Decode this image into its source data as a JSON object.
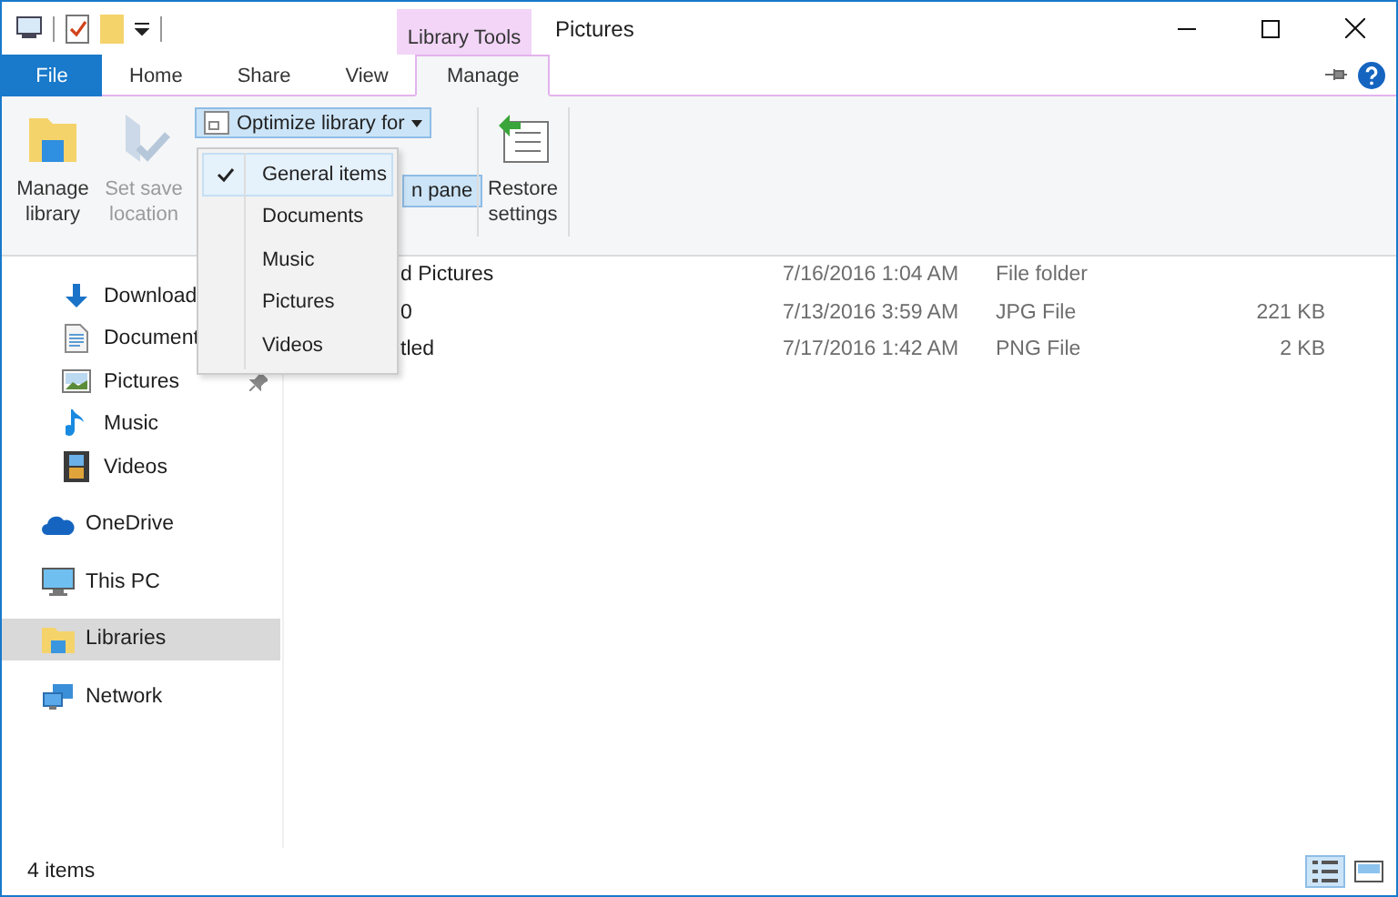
{
  "window": {
    "title": "Pictures",
    "contextual_group": "Library Tools"
  },
  "tabs": [
    {
      "label": "File",
      "kind": "file",
      "selected": false
    },
    {
      "label": "Home",
      "kind": "tab",
      "selected": false
    },
    {
      "label": "Share",
      "kind": "tab",
      "selected": false
    },
    {
      "label": "View",
      "kind": "tab",
      "selected": false
    },
    {
      "label": "Manage",
      "kind": "contextual",
      "selected": true
    }
  ],
  "ribbon": {
    "manage_library": "Manage\nlibrary",
    "set_save_location": {
      "label": "Set save\nlocation",
      "disabled": true
    },
    "optimize_button": "Optimize library for",
    "nav_pane_button": "n pane",
    "restore_settings": "Restore\nsettings"
  },
  "optimize_menu": [
    {
      "label": "General items",
      "checked": true,
      "selected": true
    },
    {
      "label": "Documents",
      "checked": false,
      "selected": false
    },
    {
      "label": "Music",
      "checked": false,
      "selected": false
    },
    {
      "label": "Pictures",
      "checked": false,
      "selected": false
    },
    {
      "label": "Videos",
      "checked": false,
      "selected": false
    }
  ],
  "quick_access_items": [
    {
      "label": "Download",
      "pinned": false
    },
    {
      "label": "Document",
      "pinned": false
    },
    {
      "label": "Pictures",
      "pinned": true
    },
    {
      "label": "Music",
      "pinned": false
    },
    {
      "label": "Videos",
      "pinned": false
    }
  ],
  "locations": [
    {
      "label": "OneDrive",
      "selected": false
    },
    {
      "label": "This PC",
      "selected": false
    },
    {
      "label": "Libraries",
      "selected": true
    },
    {
      "label": "Network",
      "selected": false
    }
  ],
  "files": [
    {
      "name": "d Pictures",
      "date": "7/16/2016 1:04 AM",
      "type": "File folder"
    },
    {
      "name": "0",
      "date": "7/13/2016 3:59 AM",
      "type": "JPG File",
      "size": "221 KB"
    },
    {
      "name": "tled",
      "date": "7/17/2016 1:42 AM",
      "type": "PNG File",
      "size": "2 KB"
    }
  ],
  "status_bar": {
    "item_count": "4 items",
    "views": [
      {
        "kind": "details",
        "selected": true
      },
      {
        "kind": "large-icons",
        "selected": false
      }
    ]
  }
}
